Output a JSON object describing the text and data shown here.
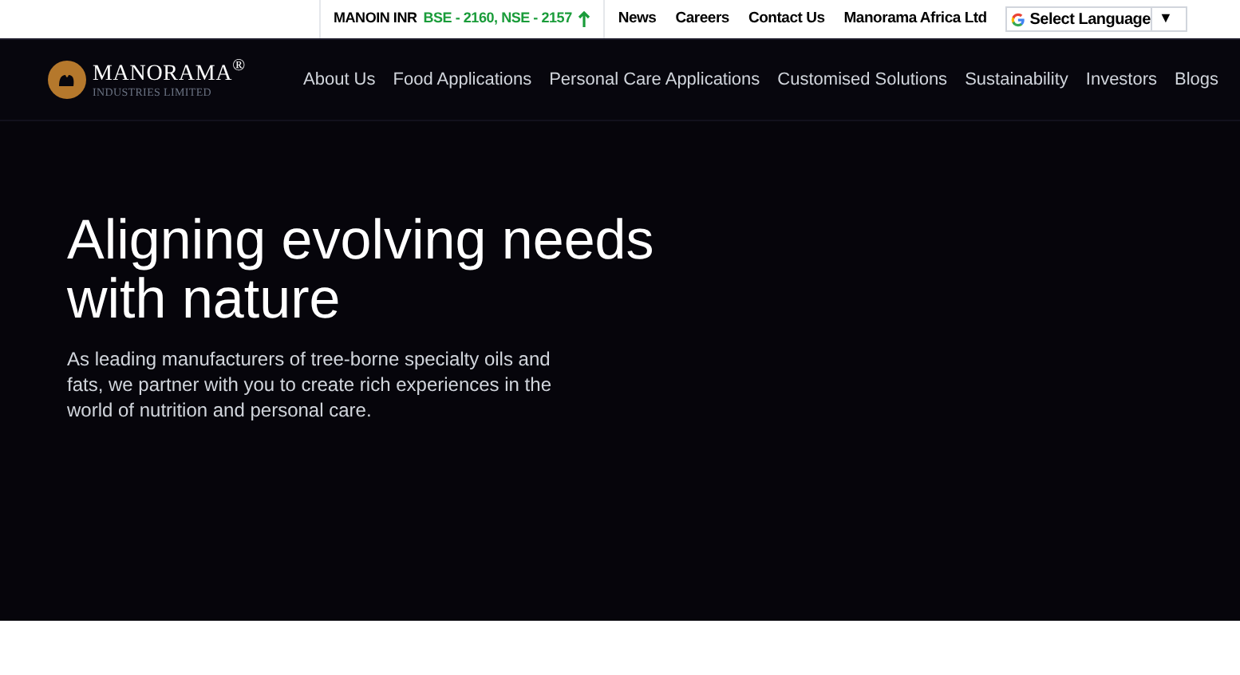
{
  "top_bar": {
    "ticker": {
      "label": "MANOIN INR",
      "quote": "BSE - 2160, NSE - 2157"
    },
    "links": [
      "News",
      "Careers",
      "Contact Us",
      "Manorama Africa Ltd"
    ],
    "language_select": {
      "label": "Select Language",
      "arrow": "▼"
    }
  },
  "header": {
    "logo": {
      "name": "MANORAMA$^{®}$",
      "tagline": "INDUSTRIES LIMITED"
    },
    "nav": [
      "About Us",
      "Food Applications",
      "Personal Care Applications",
      "Customised Solutions",
      "Sustainability",
      "Investors",
      "Blogs"
    ]
  },
  "hero": {
    "heading": "Aligning evolving needs with nature",
    "text": "As leading manufacturers of tree-borne specialty oils and fats, we partner with you to create rich experiences in the world of nutrition and personal care."
  }
}
